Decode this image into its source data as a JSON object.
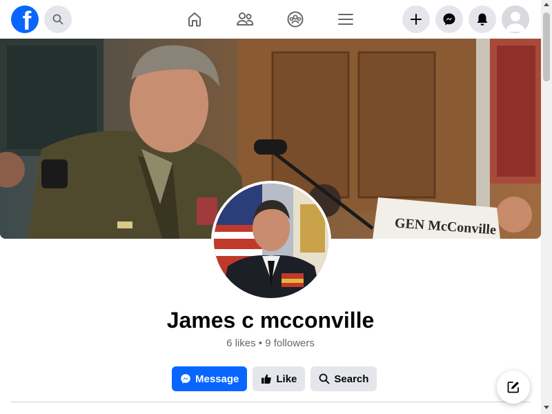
{
  "topbar": {
    "logo_letter": "f",
    "icons": {
      "logo": "facebook-logo-icon",
      "search": "search-icon",
      "home": "home-icon",
      "friends": "friends-icon",
      "groups": "groups-icon",
      "menu": "menu-icon",
      "create": "plus-icon",
      "messenger": "messenger-icon",
      "notifications": "bell-icon",
      "account": "avatar-icon"
    }
  },
  "cover": {
    "nameplate_text": "GEN McConville"
  },
  "profile": {
    "name": "James c mcconville",
    "stats": "6 likes • 9 followers"
  },
  "actions": {
    "message_label": "Message",
    "like_label": "Like",
    "search_label": "Search"
  },
  "colors": {
    "brand_blue": "#0866ff",
    "button_gray": "#e4e6eb",
    "text_primary": "#050505",
    "text_secondary": "#65676b"
  }
}
